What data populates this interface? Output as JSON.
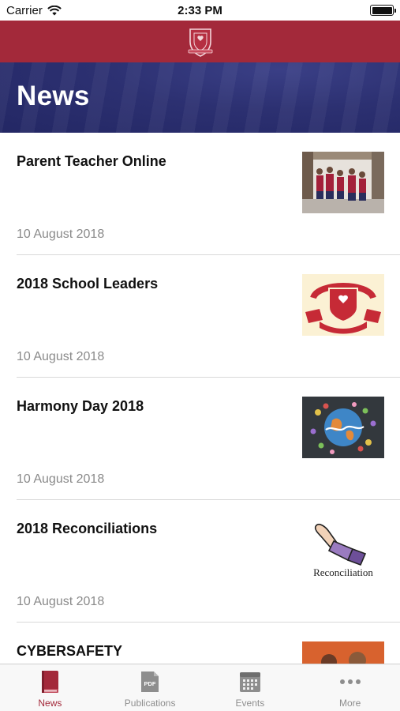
{
  "status_bar": {
    "carrier": "Carrier",
    "time": "2:33 PM"
  },
  "header": {
    "title": "News"
  },
  "news": [
    {
      "title": "Parent Teacher Online",
      "date": "10 August 2018",
      "thumb": "students-photo"
    },
    {
      "title": "2018 School Leaders",
      "date": "10 August 2018",
      "thumb": "school-crest"
    },
    {
      "title": "Harmony Day 2018",
      "date": "10 August 2018",
      "thumb": "harmony-day"
    },
    {
      "title": "2018 Reconciliations",
      "date": "10 August 2018",
      "thumb": "reconciliation",
      "thumb_text": "Reconciliation"
    },
    {
      "title": "CYBERSAFETY",
      "date": "",
      "thumb": "cybersafety-photo"
    }
  ],
  "tabs": [
    {
      "label": "News",
      "icon": "book-icon",
      "active": true
    },
    {
      "label": "Publications",
      "icon": "pdf-icon",
      "active": false
    },
    {
      "label": "Events",
      "icon": "calendar-icon",
      "active": false
    },
    {
      "label": "More",
      "icon": "more-icon",
      "active": false
    }
  ],
  "colors": {
    "brand_red": "#a3293a",
    "banner_navy": "#2c3071",
    "date_gray": "#8a8a8a"
  }
}
